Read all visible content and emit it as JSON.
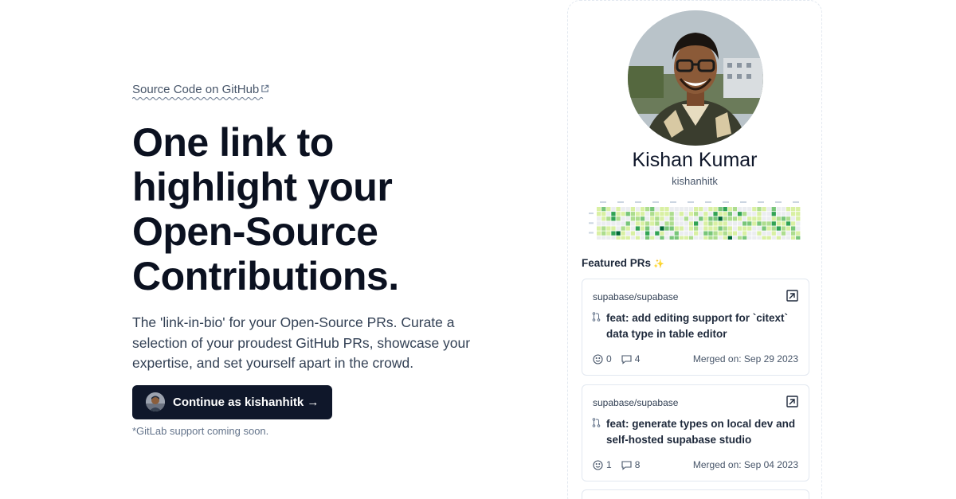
{
  "hero": {
    "source_link": "Source Code on GitHub",
    "headline": [
      "One link to",
      "highlight your",
      "Open-Source",
      "Contributions."
    ],
    "description": "The 'link-in-bio' for your Open-Source PRs. Curate a selection of your proudest GitHub PRs, showcase your expertise, and set yourself apart in the crowd.",
    "cta_label": "Continue as kishanhitk →",
    "note": "*GitLab support coming soon."
  },
  "profile": {
    "name": "Kishan Kumar",
    "username": "kishanhitk",
    "featured_title": "Featured PRs",
    "featured_icon": "sparkles-icon"
  },
  "prs": [
    {
      "repo": "supabase/supabase",
      "title": "feat: add editing support for `citext` data type in table editor",
      "reactions": "0",
      "comments": "4",
      "merged": "Merged on: Sep 29 2023"
    },
    {
      "repo": "supabase/supabase",
      "title": "feat: generate types on local dev and self-hosted supabase studio",
      "reactions": "1",
      "comments": "8",
      "merged": "Merged on: Sep 04 2023"
    }
  ],
  "colors": {
    "primary": "#0f172a",
    "heat": [
      "#ebedf0",
      "#d9f0a3",
      "#addd8e",
      "#78c679",
      "#31a354",
      "#006837"
    ]
  }
}
